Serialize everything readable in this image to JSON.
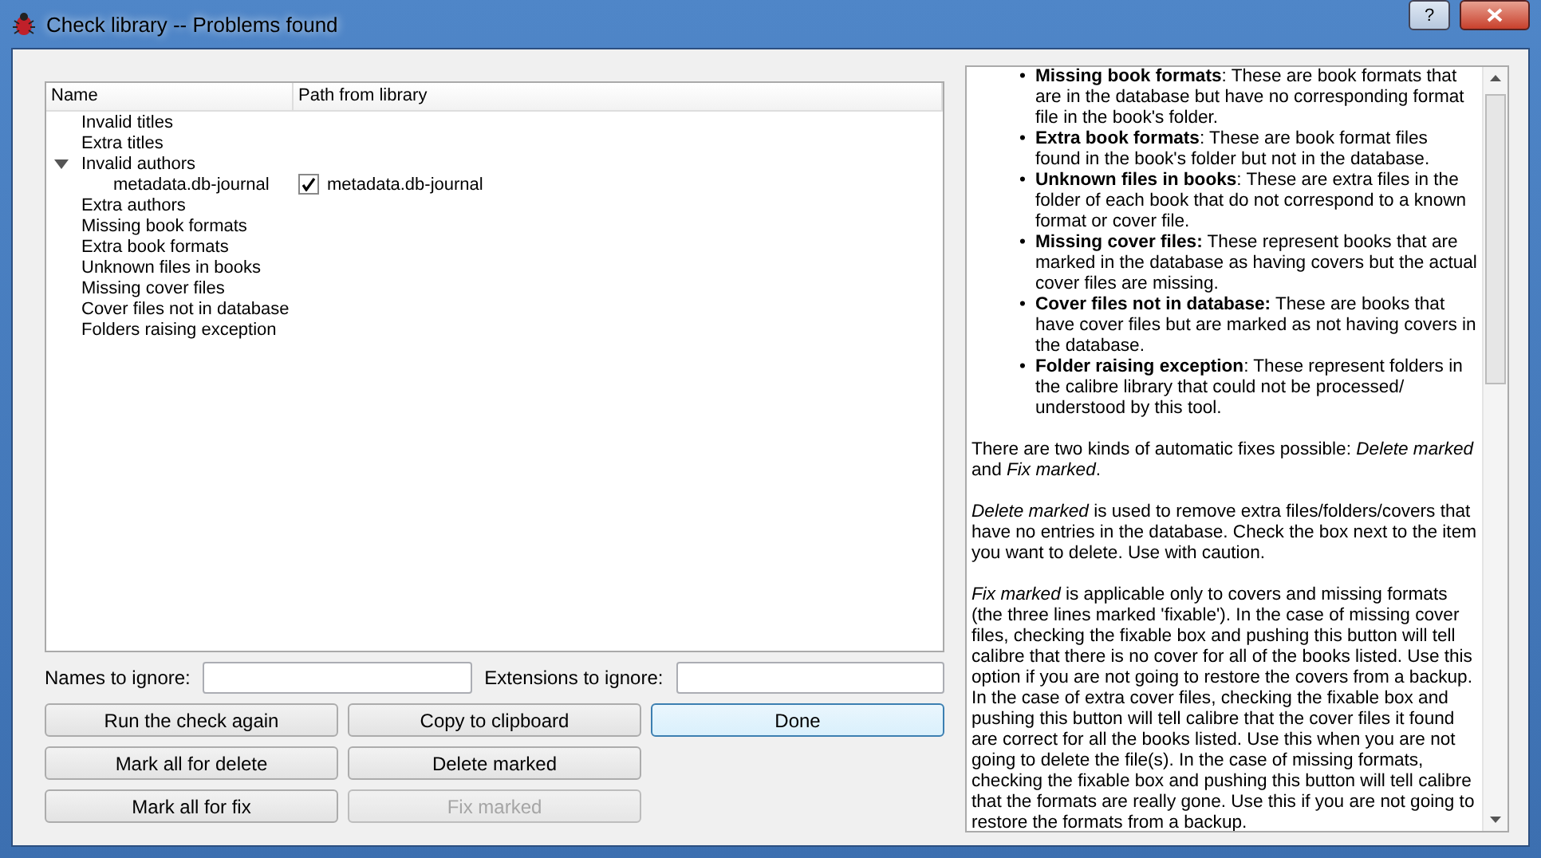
{
  "window": {
    "title": "Check library -- Problems found",
    "buttons": [
      "?"
    ]
  },
  "tree": {
    "columns": [
      "Name",
      "Path from library"
    ],
    "items": [
      {
        "name": "Invalid titles"
      },
      {
        "name": "Extra titles"
      },
      {
        "name": "Invalid authors",
        "expanded": true,
        "children": [
          {
            "name": "metadata.db-journal",
            "path": "metadata.db-journal",
            "checked": true
          }
        ]
      },
      {
        "name": "Extra authors"
      },
      {
        "name": "Missing book formats"
      },
      {
        "name": "Extra book formats"
      },
      {
        "name": "Unknown files in books"
      },
      {
        "name": "Missing cover files"
      },
      {
        "name": "Cover files not in database"
      },
      {
        "name": "Folders raising exception"
      }
    ]
  },
  "filters": [
    {
      "label": "Names to ignore:"
    },
    {
      "label": "Extensions to ignore:"
    }
  ],
  "buttons": [
    [
      {
        "label": "Run the check again",
        "disabled": false,
        "default": false
      },
      {
        "label": "Copy to clipboard",
        "disabled": false,
        "default": false
      },
      {
        "label": "Done",
        "disabled": false,
        "default": true
      }
    ],
    [
      {
        "label": "Mark all for delete",
        "disabled": false,
        "default": false
      },
      {
        "label": "Delete marked",
        "disabled": false,
        "default": false
      }
    ],
    [
      {
        "label": "Mark all for fix",
        "disabled": false,
        "default": false
      },
      {
        "label": "Fix marked",
        "disabled": true,
        "default": false
      }
    ]
  ],
  "help": {
    "bullets": [
      {
        "marker": "•",
        "text": "**Missing book formats**: These are book formats that are in the database but have no corresponding format file in the book's folder."
      },
      {
        "marker": "•",
        "text": "**Extra book formats**: These are book format files found in the book's folder but not in the database."
      },
      {
        "marker": "•",
        "text": "**Unknown files in books**: These are extra files in the folder of each book that do not correspond to a known format or cover file."
      },
      {
        "marker": "•",
        "text": "**Missing cover files:** These represent books that are marked in the database as having covers but the actual cover files are missing."
      },
      {
        "marker": "•",
        "text": "**Cover files not in database:** These are books that have cover files but are marked as not having covers in the database."
      },
      {
        "marker": "•",
        "text": "**Folder raising exception**: These represent folders in the calibre library that could not be processed/ understood by this tool."
      }
    ],
    "paragraphs": [
      "There are two kinds of automatic fixes possible: *Delete marked* and *Fix marked*.",
      "*Delete marked* is used to remove extra files/folders/covers that have no entries in the database. Check the box next to the item you want to delete. Use with caution.",
      "*Fix marked* is applicable only to covers and missing formats (the three lines marked 'fixable'). In the case of missing cover files, checking the fixable box and pushing this button will tell calibre that there is no cover for all of the books listed. Use this option if you are not going to restore the covers from a backup. In the case of extra cover files, checking the fixable box and pushing this button will tell calibre that the cover files it found are correct for all the books listed. Use this when you are not going to delete the file(s). In the case of missing formats, checking the fixable box and pushing this button will tell calibre that the formats are really gone. Use this if you are not going to restore the formats from a backup."
    ]
  }
}
